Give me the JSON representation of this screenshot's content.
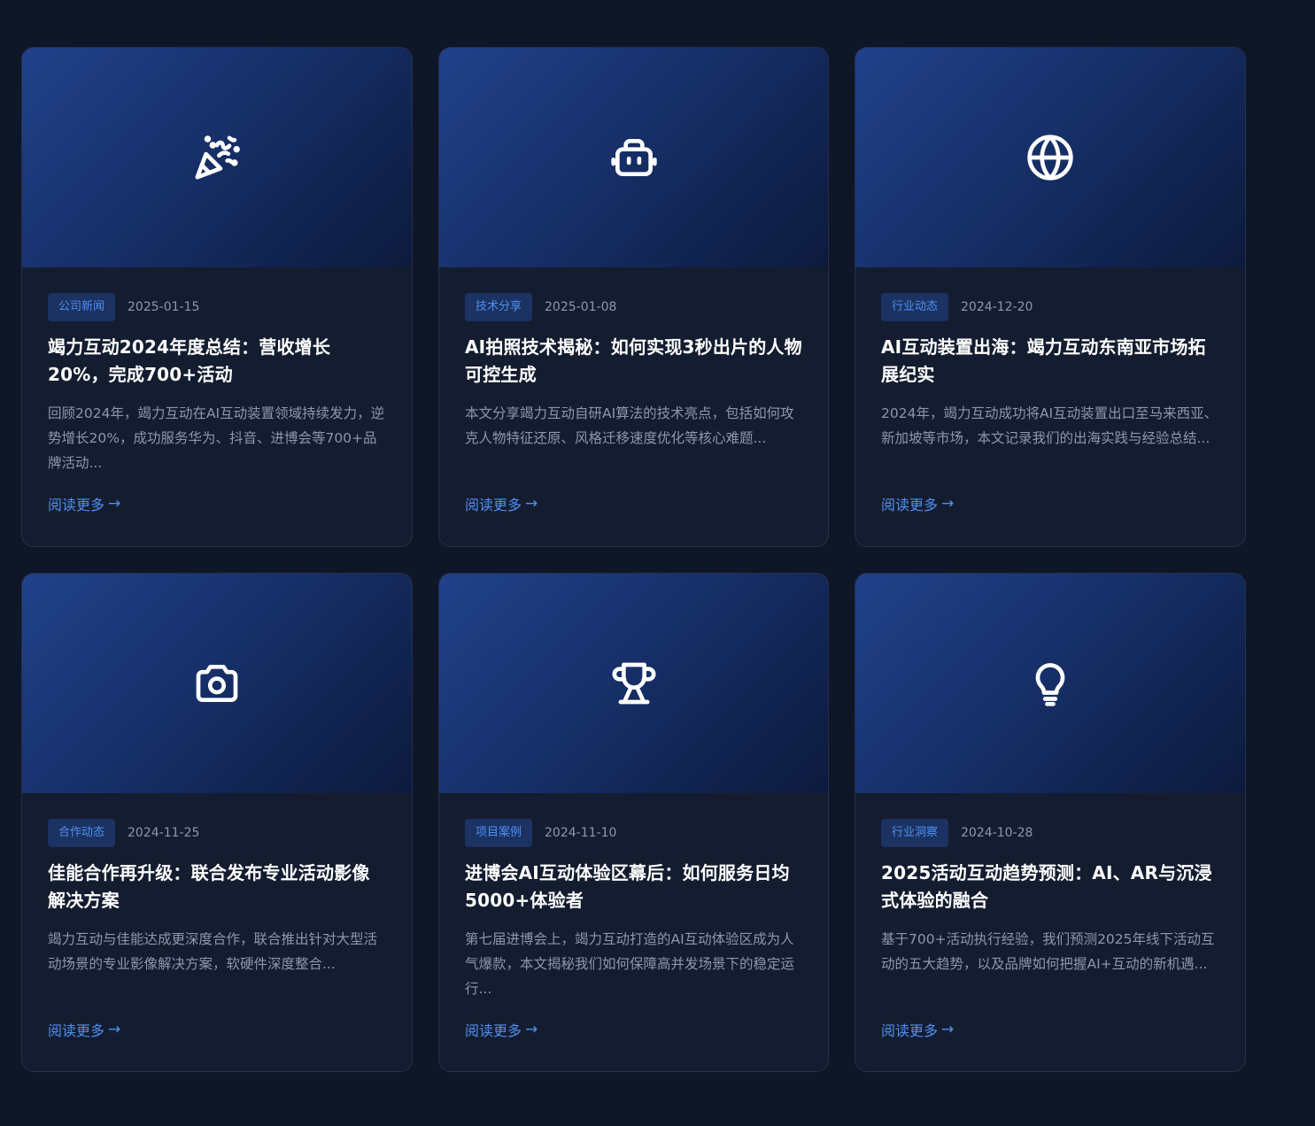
{
  "read_more_label": "阅读更多",
  "arrow": "→",
  "colors": {
    "background": "#0e1628",
    "card": "#141d30",
    "accent": "#4f8ff0",
    "tag_bg": "#1b3262",
    "hero_gradient_start": "#21418a",
    "hero_gradient_end": "#0c1a3c"
  },
  "cards": [
    {
      "icon": "party-popper-icon",
      "tag": "公司新闻",
      "date": "2025-01-15",
      "title": "竭力互动2024年度总结：营收增长20%，完成700+活动",
      "excerpt": "回顾2024年，竭力互动在AI互动装置领域持续发力，逆势增长20%，成功服务华为、抖音、进博会等700+品牌活动..."
    },
    {
      "icon": "robot-icon",
      "tag": "技术分享",
      "date": "2025-01-08",
      "title": "AI拍照技术揭秘：如何实现3秒出片的人物可控生成",
      "excerpt": "本文分享竭力互动自研AI算法的技术亮点，包括如何攻克人物特征还原、风格迁移速度优化等核心难题..."
    },
    {
      "icon": "globe-icon",
      "tag": "行业动态",
      "date": "2024-12-20",
      "title": "AI互动装置出海：竭力互动东南亚市场拓展纪实",
      "excerpt": "2024年，竭力互动成功将AI互动装置出口至马来西亚、新加坡等市场，本文记录我们的出海实践与经验总结..."
    },
    {
      "icon": "camera-icon",
      "tag": "合作动态",
      "date": "2024-11-25",
      "title": "佳能合作再升级：联合发布专业活动影像解决方案",
      "excerpt": "竭力互动与佳能达成更深度合作，联合推出针对大型活动场景的专业影像解决方案，软硬件深度整合..."
    },
    {
      "icon": "trophy-icon",
      "tag": "项目案例",
      "date": "2024-11-10",
      "title": "进博会AI互动体验区幕后：如何服务日均5000+体验者",
      "excerpt": "第七届进博会上，竭力互动打造的AI互动体验区成为人气爆款，本文揭秘我们如何保障高并发场景下的稳定运行..."
    },
    {
      "icon": "lightbulb-icon",
      "tag": "行业洞察",
      "date": "2024-10-28",
      "title": "2025活动互动趋势预测：AI、AR与沉浸式体验的融合",
      "excerpt": "基于700+活动执行经验，我们预测2025年线下活动互动的五大趋势，以及品牌如何把握AI+互动的新机遇..."
    }
  ]
}
